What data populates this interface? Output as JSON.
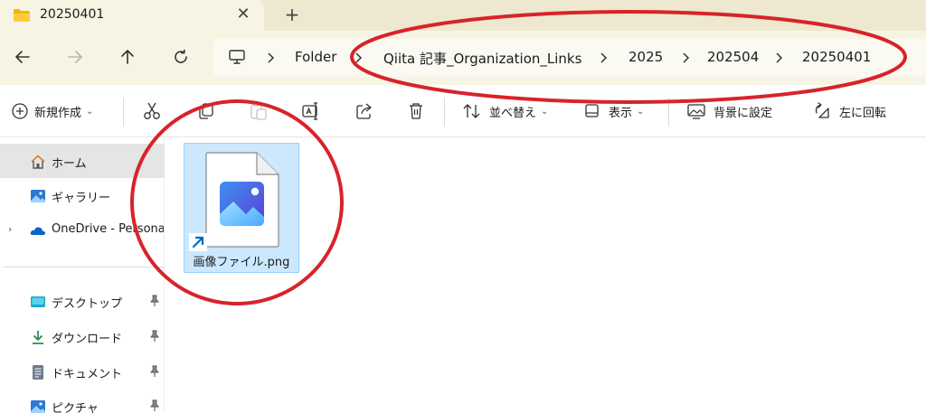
{
  "window": {
    "tab_title": "20250401",
    "tab_close_glyph": "✕",
    "new_tab_glyph": "+"
  },
  "breadcrumb": {
    "items": [
      "Folder",
      "Qiita 記事_Organization_Links",
      "2025",
      "202504",
      "20250401"
    ]
  },
  "toolbar": {
    "new_label": "新規作成",
    "sort_label": "並べ替え",
    "view_label": "表示",
    "set_background_label": "背景に設定",
    "rotate_left_label": "左に回転"
  },
  "sidebar": {
    "items": [
      {
        "label": "ホーム",
        "icon": "home-icon"
      },
      {
        "label": "ギャラリー",
        "icon": "gallery-icon"
      },
      {
        "label": "OneDrive - Persona",
        "icon": "onedrive-icon"
      },
      {
        "label": "デスクトップ",
        "icon": "desktop-icon"
      },
      {
        "label": "ダウンロード",
        "icon": "download-icon"
      },
      {
        "label": "ドキュメント",
        "icon": "documents-icon"
      },
      {
        "label": "ピクチャ",
        "icon": "pictures-icon"
      }
    ]
  },
  "files": [
    {
      "name": "画像ファイル.png",
      "selected": true,
      "is_shortcut": true
    }
  ],
  "annotations": [
    {
      "shape": "ellipse",
      "color": "#d8232a",
      "target": "breadcrumb"
    },
    {
      "shape": "ellipse",
      "color": "#d8232a",
      "target": "file-item"
    }
  ],
  "colors": {
    "tab_strip": "#ede8cf",
    "tab_active": "#f7f4e4",
    "selection": "#cce8ff",
    "selection_border": "#99d1ff",
    "annotation_red": "#d8232a",
    "accent_blue": "#0067c0"
  }
}
